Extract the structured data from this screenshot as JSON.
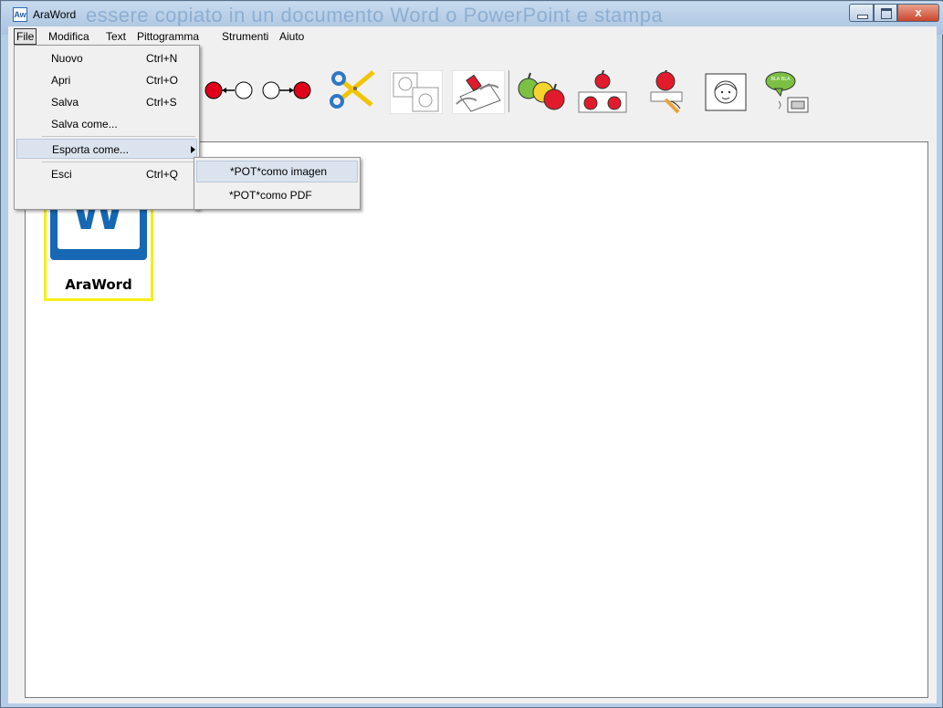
{
  "window": {
    "title": "AraWord",
    "icon_text": "Aw",
    "background_text": "essere copiato in un documento Word o PowerPoint e stampa",
    "controls": {
      "minimize": "–",
      "maximize": "□",
      "close": "x"
    }
  },
  "menubar": {
    "items": [
      "File",
      "Modifica",
      "Text",
      "Pittogramma",
      "Strumenti",
      "Aiuto"
    ]
  },
  "file_menu": {
    "items": [
      {
        "label": "Nuovo",
        "shortcut": "Ctrl+N"
      },
      {
        "label": "Apri",
        "shortcut": "Ctrl+O"
      },
      {
        "label": "Salva",
        "shortcut": "Ctrl+S"
      },
      {
        "label": "Salva come...",
        "shortcut": ""
      },
      {
        "label": "Esporta come...",
        "shortcut": ""
      },
      {
        "label": "Esci",
        "shortcut": "Ctrl+Q"
      }
    ]
  },
  "export_submenu": {
    "items": [
      "*POT*como imagen",
      "*POT*como PDF"
    ]
  },
  "toolbar": {
    "buttons": [
      "move-left-icon",
      "move-right-icon",
      "scissors-icon",
      "copy-pictogram-icon",
      "paste-glue-icon",
      "plural-apples-icon",
      "change-colors-icon",
      "write-label-icon",
      "face-portrait-icon",
      "speech-icon"
    ]
  },
  "document": {
    "tile_caption": "AraWord",
    "tile_letter": "W"
  },
  "colors": {
    "title_bar": "#b6cde6",
    "close_button": "#c9452b",
    "tile_border": "#f7ee17",
    "logo_blue": "#1668b4"
  }
}
